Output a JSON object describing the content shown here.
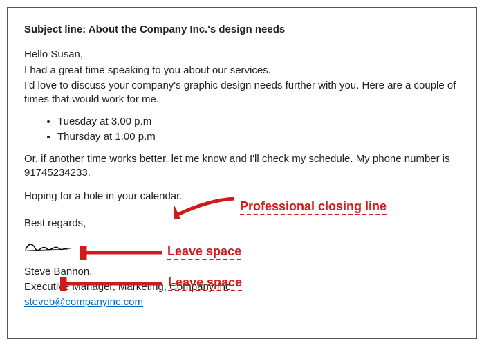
{
  "subject_prefix": "Subject line: ",
  "subject_text": "About the Company Inc.'s design needs",
  "greeting": "Hello Susan,",
  "intro_1": "I had a great time speaking to you about our services.",
  "intro_2": "I'd love to discuss your company's graphic design needs further with you. Here are a couple of times that would work for me.",
  "times": [
    "Tuesday at 3.00 p.m",
    "Thursday at 1.00 p.m"
  ],
  "alt_line": "Or, if another time works better, let me know and I'll check my schedule. My phone number is 91745234233.",
  "closing_line": "Hoping for a hole in your calendar.",
  "signoff": "Best regards,",
  "sender": {
    "name": "Steve Bannon.",
    "title": "Executive Manager, Marketing, Company Inc.",
    "email": "steveb@companyinc.com"
  },
  "annotations": {
    "closing": "Professional closing line",
    "space1": "Leave space",
    "space2": "Leave space"
  }
}
